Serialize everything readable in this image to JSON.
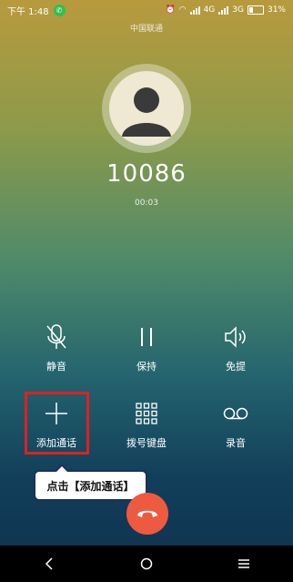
{
  "status_bar": {
    "time": "下午 1:48",
    "network1": "4G",
    "network2": "3G",
    "battery": "31%"
  },
  "carrier": "中国联通",
  "call": {
    "number": "10086",
    "duration": "00:03"
  },
  "controls": {
    "mute": "静音",
    "hold": "保持",
    "speaker": "免提",
    "add_call": "添加通话",
    "keypad": "拨号键盘",
    "record": "录音"
  },
  "tooltip": "点击【添加通话】",
  "colors": {
    "hangup": "#ee5a40",
    "highlight": "#e21f1f",
    "call_badge": "#2fbf55"
  }
}
